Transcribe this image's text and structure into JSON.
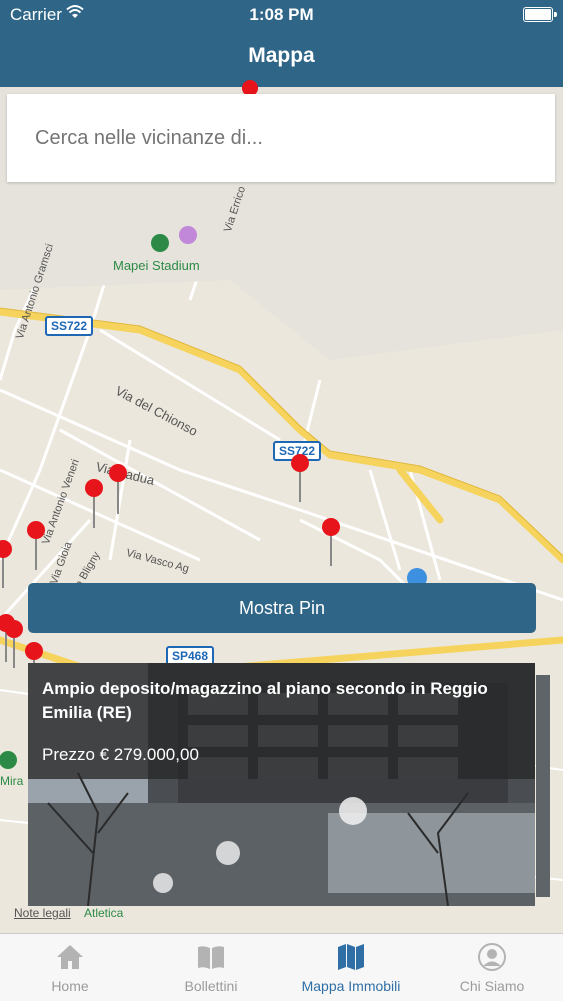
{
  "status_bar": {
    "carrier": "Carrier",
    "time": "1:08 PM"
  },
  "nav": {
    "title": "Mappa"
  },
  "search": {
    "placeholder": "Cerca nelle vicinanze di..."
  },
  "map": {
    "poi_mapei": "Mapei Stadium",
    "poi_atletica": "Atletica",
    "poi_mira": "Mira",
    "legal": "Note legali",
    "road_labels": {
      "gramsci": "Via Antonio Gramsci",
      "errico": "Via Errico",
      "chionso": "Via del Chionso",
      "padua": "Via Padua",
      "veneri": "Via Antonio Veneri",
      "gioia": "Via Gioia",
      "bligny": "Via Bligny",
      "vasco": "Via Vasco Ag"
    },
    "shields": {
      "ss722_a": "SS722",
      "ss722_b": "SS722",
      "sp468": "SP468"
    },
    "pin_color": "#e8141c"
  },
  "show_pin_label": "Mostra Pin",
  "listing": {
    "title": "Ampio deposito/magazzino al piano secondo in Reggio Emilia (RE)",
    "price": "Prezzo € 279.000,00"
  },
  "tabs": [
    {
      "label": "Home",
      "icon": "home-icon"
    },
    {
      "label": "Bollettini",
      "icon": "book-icon"
    },
    {
      "label": "Mappa Immobili",
      "icon": "map-icon"
    },
    {
      "label": "Chi Siamo",
      "icon": "person-icon"
    }
  ],
  "colors": {
    "primary": "#2f6688",
    "tab_active": "#2f6fa6",
    "road_major": "#f5d35c"
  }
}
